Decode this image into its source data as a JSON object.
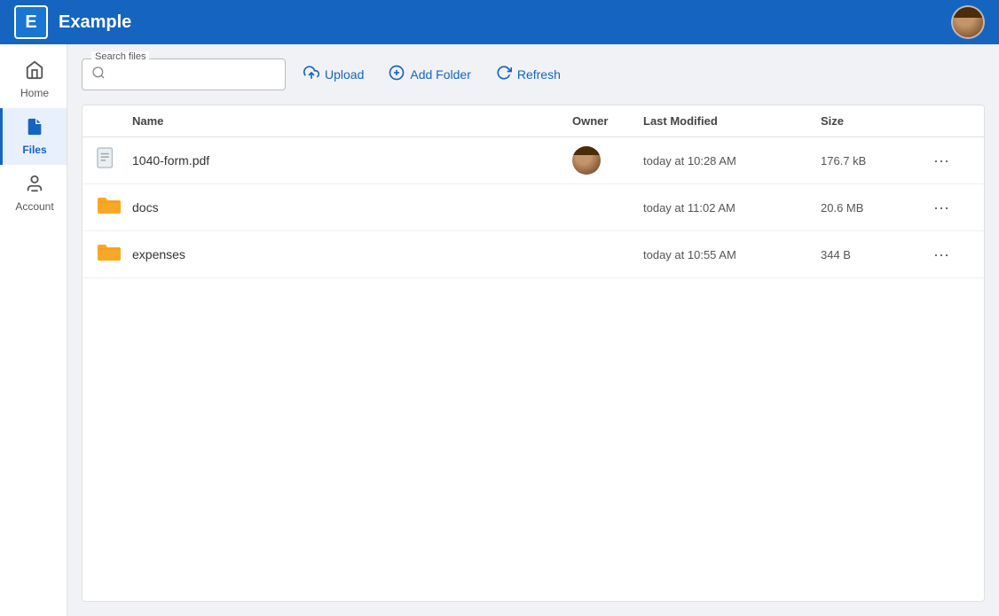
{
  "app": {
    "logo_letter": "E",
    "title": "Example"
  },
  "header": {
    "avatar_alt": "User avatar"
  },
  "sidebar": {
    "items": [
      {
        "id": "home",
        "label": "Home",
        "icon": "🏠",
        "active": false
      },
      {
        "id": "files",
        "label": "Files",
        "icon": "📄",
        "active": true
      },
      {
        "id": "account",
        "label": "Account",
        "icon": "👤",
        "active": false
      }
    ]
  },
  "toolbar": {
    "search_label": "Search files",
    "search_placeholder": "",
    "upload_label": "Upload",
    "add_folder_label": "Add Folder",
    "refresh_label": "Refresh"
  },
  "table": {
    "columns": [
      "Name",
      "Owner",
      "Last Modified",
      "Size",
      ""
    ],
    "rows": [
      {
        "id": "row-1",
        "type": "file",
        "name": "1040-form.pdf",
        "has_owner": true,
        "last_modified": "today at 10:28 AM",
        "size": "176.7 kB"
      },
      {
        "id": "row-2",
        "type": "folder",
        "name": "docs",
        "has_owner": false,
        "last_modified": "today at 11:02 AM",
        "size": "20.6 MB"
      },
      {
        "id": "row-3",
        "type": "folder",
        "name": "expenses",
        "has_owner": false,
        "last_modified": "today at 10:55 AM",
        "size": "344 B"
      }
    ]
  }
}
